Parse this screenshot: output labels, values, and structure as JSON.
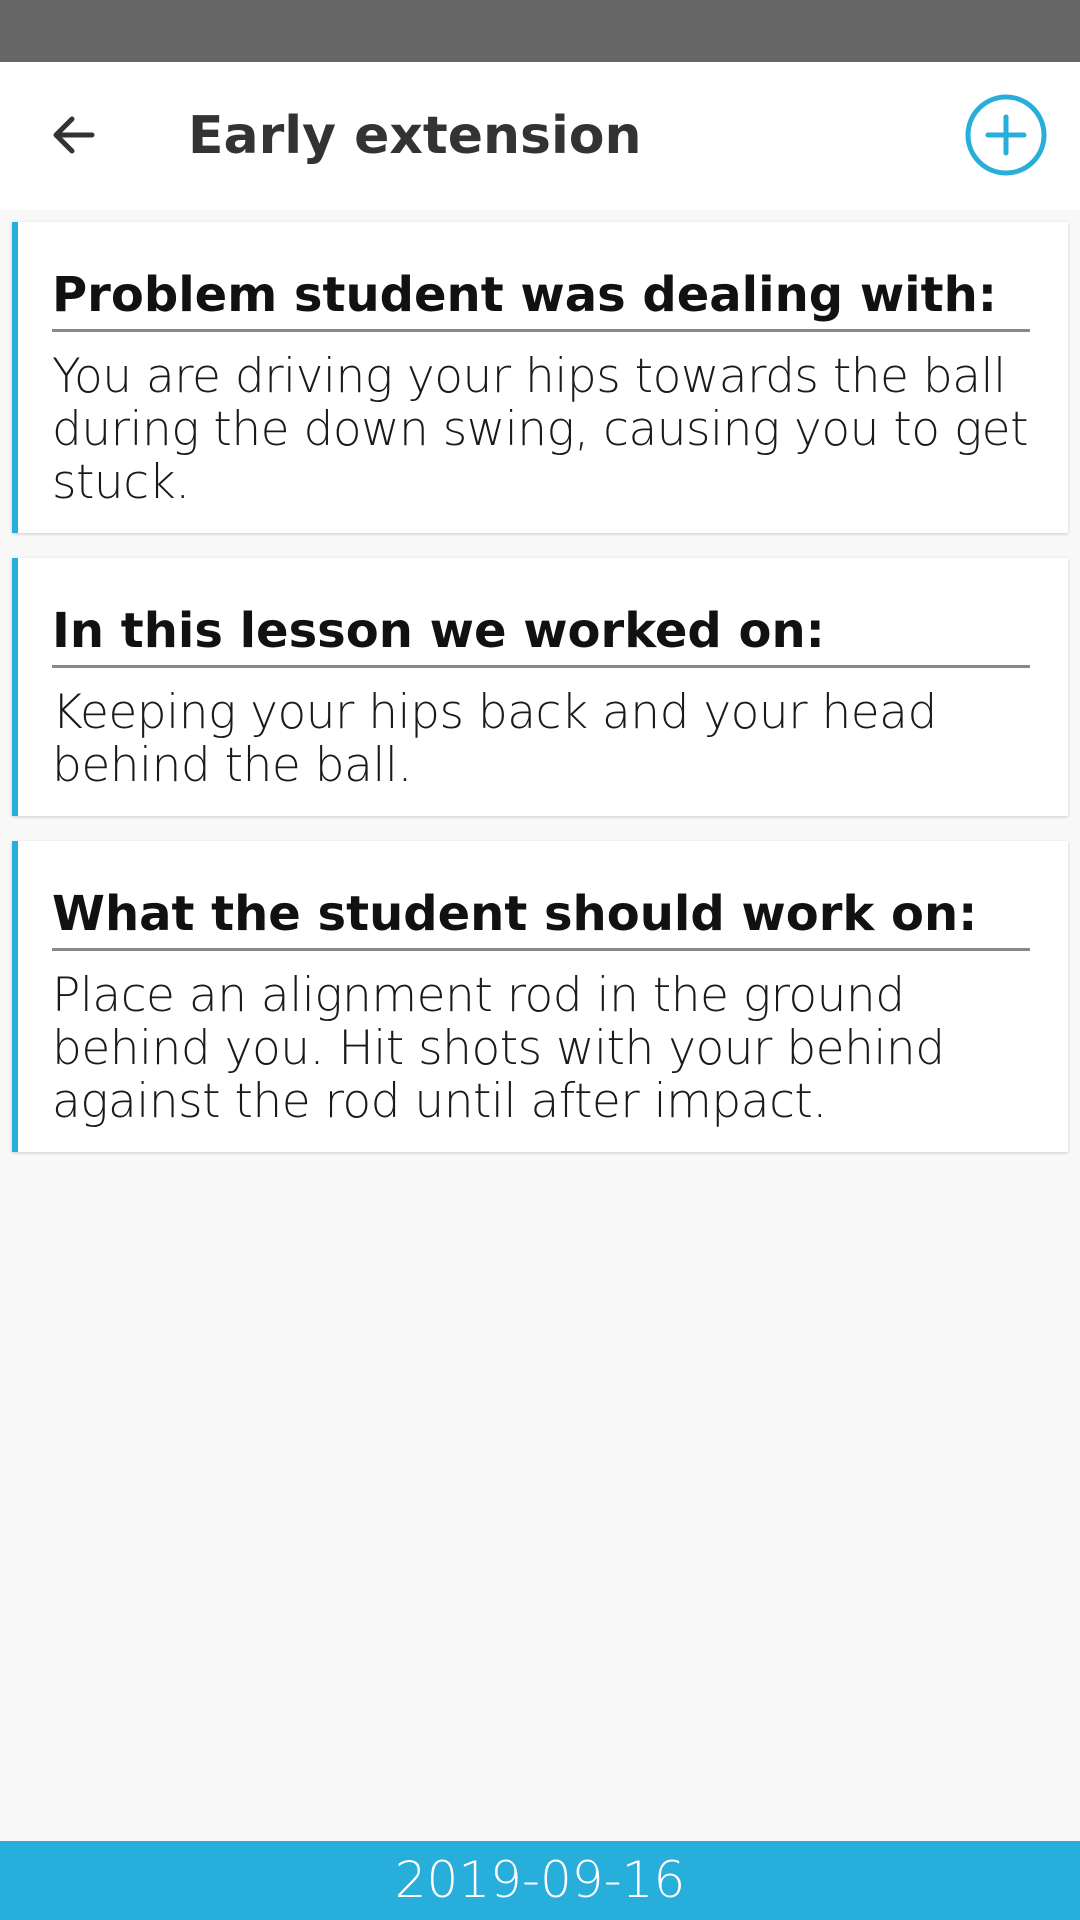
{
  "header": {
    "title": "Early extension",
    "back_icon": "arrow-left-icon",
    "add_icon": "plus-circle-icon"
  },
  "sections": [
    {
      "heading": "Problem student was dealing with:",
      "body": "You are driving your hips towards the ball during the down swing, causing you to get stuck."
    },
    {
      "heading": "In this lesson we worked on:",
      "body": "Keeping your hips back and your head behind the ball."
    },
    {
      "heading": "What the student should work on:",
      "body": "Place an alignment rod in the ground behind you. Hit shots with your behind against the rod until after impact."
    }
  ],
  "footer": {
    "date": "2019-09-16"
  },
  "colors": {
    "accent": "#27aedb",
    "status_bar": "#666666",
    "background": "#f8f8f8"
  }
}
